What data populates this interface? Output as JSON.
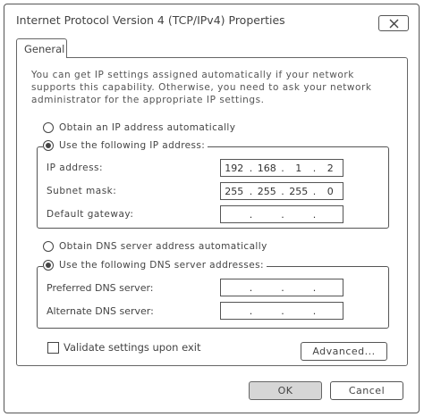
{
  "window": {
    "title": "Internet Protocol Version 4 (TCP/IPv4) Properties"
  },
  "tabs": [
    {
      "label": "General"
    }
  ],
  "description": "You can get IP settings assigned automatically if your network supports this capability. Otherwise, you need to ask your network administrator for the appropriate IP settings.",
  "ip_section": {
    "auto_label": "Obtain an IP address automatically",
    "manual_label": "Use the following IP address:",
    "selected": "manual",
    "fields": [
      {
        "label": "IP address:",
        "octets": [
          "192",
          "168",
          "1",
          "2"
        ]
      },
      {
        "label": "Subnet mask:",
        "octets": [
          "255",
          "255",
          "255",
          "0"
        ]
      },
      {
        "label": "Default gateway:",
        "octets": [
          "",
          "",
          "",
          ""
        ]
      }
    ]
  },
  "dns_section": {
    "auto_label": "Obtain DNS server address automatically",
    "manual_label": "Use the following DNS server addresses:",
    "selected": "manual",
    "fields": [
      {
        "label": "Preferred DNS server:",
        "octets": [
          "",
          "",
          "",
          ""
        ]
      },
      {
        "label": "Alternate DNS server:",
        "octets": [
          "",
          "",
          "",
          ""
        ]
      }
    ]
  },
  "validate": {
    "label": "Validate settings upon exit",
    "checked": false
  },
  "buttons": {
    "advanced": "Advanced...",
    "ok": "OK",
    "cancel": "Cancel"
  }
}
